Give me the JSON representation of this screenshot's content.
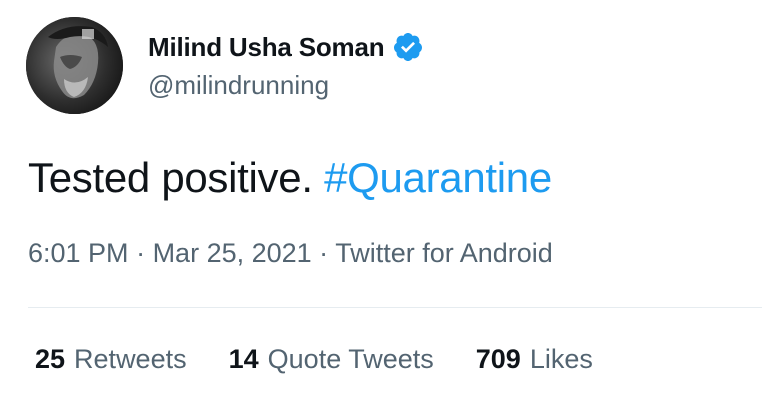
{
  "user": {
    "display_name": "Milind Usha Soman",
    "handle": "@milindrunning",
    "verified": true
  },
  "tweet": {
    "text": "Tested positive. ",
    "hashtag": "#Quarantine",
    "time": "6:01 PM",
    "separator": " · ",
    "date": "Mar 25, 2021",
    "source": "Twitter for Android"
  },
  "stats": {
    "retweets_count": "25",
    "retweets_label": "Retweets",
    "quotes_count": "14",
    "quotes_label": "Quote Tweets",
    "likes_count": "709",
    "likes_label": "Likes"
  },
  "colors": {
    "link": "#1d9bf0",
    "secondary_text": "#536471",
    "primary_text": "#0f1419",
    "divider": "#e6ecf0"
  }
}
